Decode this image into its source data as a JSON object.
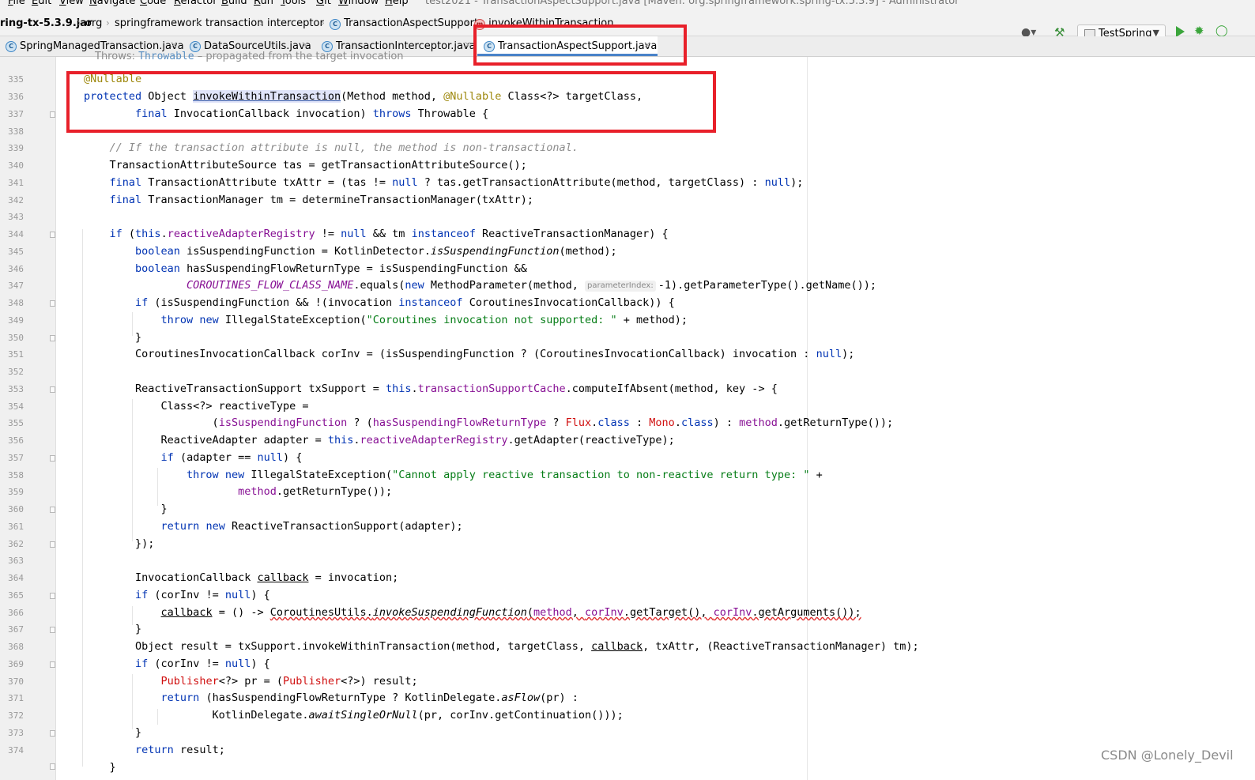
{
  "menu": {
    "items": [
      "File",
      "Edit",
      "View",
      "Navigate",
      "Code",
      "Refactor",
      "Build",
      "Run",
      "Tools",
      "Git",
      "Window",
      "Help"
    ],
    "window_title": "test2021 - TransactionAspectSupport.java [Maven: org.springframework:spring-tx:5.3.9] - Administrator"
  },
  "breadcrumb": {
    "items": [
      "ring-tx-5.3.9.jar",
      "org",
      "springframework",
      "transaction",
      "interceptor",
      "TransactionAspectSupport",
      "invokeWithinTransaction"
    ],
    "class_icon": "class-icon",
    "method_icon": "method-icon"
  },
  "toolbar": {
    "run_config": "TestSpring",
    "icons": [
      "user-icon",
      "hammer-icon",
      "run-icon",
      "debug-icon",
      "more-icon"
    ]
  },
  "tabs": [
    {
      "label": "SpringManagedTransaction.java",
      "active": false
    },
    {
      "label": "DataSourceUtils.java",
      "active": false
    },
    {
      "label": "TransactionInterceptor.java",
      "active": false
    },
    {
      "label": "TransactionAspectSupport.java",
      "active": true
    }
  ],
  "editor": {
    "doc_hint_prefix": "Throws: ",
    "doc_hint_type": "Throwable",
    "doc_hint_suffix": " – propagated from the target invocation",
    "line_numbers": [
      "335",
      "336",
      "337",
      "338",
      "339",
      "340",
      "341",
      "342",
      "343",
      "344",
      "345",
      "346",
      "347",
      "348",
      "349",
      "350",
      "351",
      "352",
      "353",
      "354",
      "355",
      "356",
      "357",
      "358",
      "359",
      "360",
      "361",
      "362",
      "363",
      "364",
      "365",
      "366",
      "367",
      "368",
      "369",
      "370",
      "371",
      "372",
      "373",
      "374"
    ],
    "inline_hint": "parameterIndex:",
    "code": {
      "l335": "@Nullable",
      "l336a": "protected",
      "l336b": " Object ",
      "l336c": "invokeWithinTransaction",
      "l336d": "(Method method, ",
      "l336e": "@Nullable",
      "l336f": " Class<?> targetClass,",
      "l337a": "        ",
      "l337b": "final",
      "l337c": " InvocationCallback invocation) ",
      "l337d": "throws",
      "l337e": " Throwable {",
      "l339": "    // If the transaction attribute is null, the method is non-transactional.",
      "l340": "    TransactionAttributeSource tas = getTransactionAttributeSource();",
      "l341a": "    ",
      "l341b": "final",
      "l341c": " TransactionAttribute txAttr = (tas != ",
      "l341d": "null",
      "l341e": " ? tas.getTransactionAttribute(method, targetClass) : ",
      "l341f": "null",
      "l341g": ");",
      "l342a": "    ",
      "l342b": "final",
      "l342c": " TransactionManager tm = determineTransactionManager(txAttr);",
      "l344a": "    ",
      "l344b": "if",
      "l344c": " (",
      "l344d": "this",
      "l344e": ".",
      "l344f": "reactiveAdapterRegistry",
      "l344g": " != ",
      "l344h": "null",
      "l344i": " && tm ",
      "l344j": "instanceof",
      "l344k": " ReactiveTransactionManager) {",
      "l345a": "        ",
      "l345b": "boolean",
      "l345c": " isSuspendingFunction = KotlinDetector.",
      "l345d": "isSuspendingFunction",
      "l345e": "(method);",
      "l346a": "        ",
      "l346b": "boolean",
      "l346c": " hasSuspendingFlowReturnType = isSuspendingFunction &&",
      "l347a": "                ",
      "l347b": "COROUTINES_FLOW_CLASS_NAME",
      "l347c": ".equals(",
      "l347d": "new",
      "l347e": " MethodParameter(method, ",
      "l347f": "-1).getParameterType().getName());",
      "l348a": "        ",
      "l348b": "if",
      "l348c": " (isSuspendingFunction && !(invocation ",
      "l348d": "instanceof",
      "l348e": " CoroutinesInvocationCallback)) {",
      "l349a": "            ",
      "l349b": "throw",
      "l349c": " ",
      "l349d": "new",
      "l349e": " IllegalStateException(",
      "l349f": "\"Coroutines invocation not supported: \"",
      "l349g": " + method);",
      "l350": "        }",
      "l351a": "        CoroutinesInvocationCallback corInv = (isSuspendingFunction ? (CoroutinesInvocationCallback) invocation : ",
      "l351b": "null",
      "l351c": ");",
      "l353a": "        ReactiveTransactionSupport txSupport = ",
      "l353b": "this",
      "l353c": ".",
      "l353d": "transactionSupportCache",
      "l353e": ".computeIfAbsent(method, key -> {",
      "l354": "            Class<?> reactiveType =",
      "l355a": "                    (",
      "l355b": "isSuspendingFunction",
      "l355c": " ? (",
      "l355d": "hasSuspendingFlowReturnType",
      "l355e": " ? ",
      "l355f": "Flux",
      "l355g": ".",
      "l355h": "class",
      "l355i": " : ",
      "l355j": "Mono",
      "l355k": ".",
      "l355l": "class",
      "l355m": ") : ",
      "l355n": "method",
      "l355o": ".getReturnType());",
      "l356a": "            ReactiveAdapter adapter = ",
      "l356b": "this",
      "l356c": ".",
      "l356d": "reactiveAdapterRegistry",
      "l356e": ".getAdapter(reactiveType);",
      "l357a": "            ",
      "l357b": "if",
      "l357c": " (adapter == ",
      "l357d": "null",
      "l357e": ") {",
      "l358a": "                ",
      "l358b": "throw",
      "l358c": " ",
      "l358d": "new",
      "l358e": " IllegalStateException(",
      "l358f": "\"Cannot apply reactive transaction to non-reactive return type: \"",
      "l358g": " +",
      "l359a": "                        ",
      "l359b": "method",
      "l359c": ".getReturnType());",
      "l360": "            }",
      "l361a": "            ",
      "l361b": "return",
      "l361c": " ",
      "l361d": "new",
      "l361e": " ReactiveTransactionSupport(adapter);",
      "l362": "        });",
      "l364a": "        InvocationCallback ",
      "l364b": "callback",
      "l364c": " = invocation;",
      "l365a": "        ",
      "l365b": "if",
      "l365c": " (corInv != ",
      "l365d": "null",
      "l365e": ") {",
      "l366a": "            ",
      "l366b": "callback",
      "l366c": " = () -> ",
      "l366d": "CoroutinesUtils.",
      "l366e": "invokeSuspendingFunction",
      "l366f": "(",
      "l366g": "method",
      "l366h": ", ",
      "l366i": "corInv",
      "l366j": ".getTarget(), ",
      "l366k": "corInv",
      "l366l": ".getArguments());",
      "l367": "        }",
      "l368a": "        Object result = txSupport.invokeWithinTransaction(method, targetClass, ",
      "l368b": "callback",
      "l368c": ", txAttr, (ReactiveTransactionManager) tm);",
      "l369a": "        ",
      "l369b": "if",
      "l369c": " (corInv != ",
      "l369d": "null",
      "l369e": ") {",
      "l370a": "            ",
      "l370b": "Publisher",
      "l370c": "<?> pr = (",
      "l370d": "Publisher",
      "l370e": "<?>) result;",
      "l371a": "            ",
      "l371b": "return",
      "l371c": " (hasSuspendingFlowReturnType ? KotlinDelegate.",
      "l371d": "asFlow",
      "l371e": "(pr) :",
      "l372a": "                    KotlinDelegate.",
      "l372b": "awaitSingleOrNull",
      "l372c": "(pr, corInv.getContinuation()));",
      "l373": "        }",
      "l374a": "        ",
      "l374b": "return",
      "l374c": " result;",
      "l375": "    }"
    }
  },
  "colors": {
    "highlight_box": "#e8202a",
    "keyword": "#0033b3",
    "annotation": "#9e880d",
    "string": "#067d17",
    "field": "#871094"
  },
  "watermark": "CSDN @Lonely_Devil"
}
